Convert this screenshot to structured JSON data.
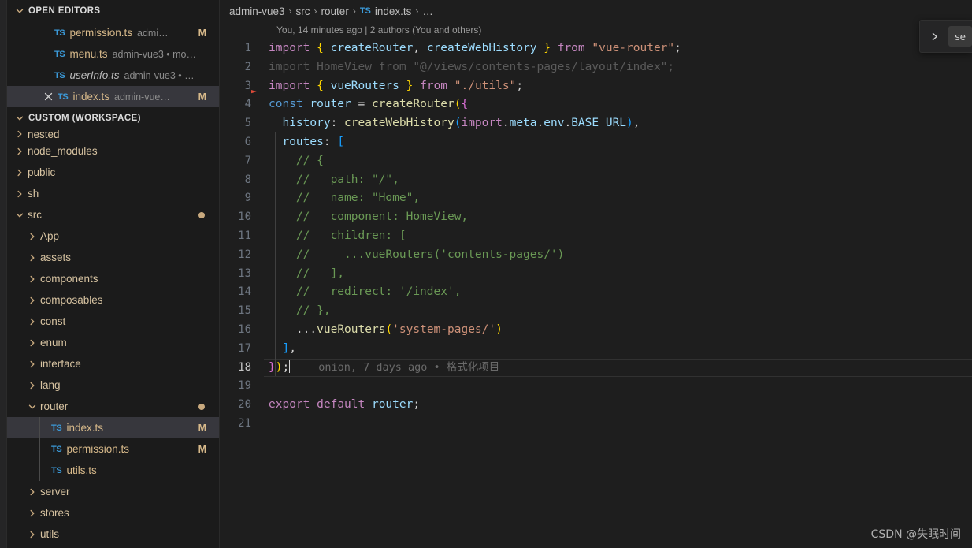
{
  "colors": {
    "editor_bg": "#1e1e1e",
    "sidebar_bg": "#1b1b1b",
    "selection_bg": "#37373d",
    "accent": "#3b9ad9",
    "modified_badge": "#d7b98a",
    "comment": "#6A9955",
    "keyword": "#C586C0",
    "string": "#CE9178",
    "function": "#DCDCAA",
    "variable": "#9CDCFE",
    "bracket1": "#FFD700",
    "breakpoint_marker": "#e04b3a"
  },
  "sidebar": {
    "open_editors": {
      "label": "OPEN EDITORS",
      "twisty": "chevron-down-icon",
      "items": [
        {
          "badge": "TS",
          "name": "permission.ts",
          "meta": "admi…",
          "status": "M",
          "selected": false,
          "italic": false,
          "closable": false
        },
        {
          "badge": "TS",
          "name": "menu.ts",
          "meta": "admin-vue3 • mo…",
          "status": "",
          "selected": false,
          "italic": false,
          "closable": false
        },
        {
          "badge": "TS",
          "name": "userInfo.ts",
          "meta": "admin-vue3 • …",
          "status": "",
          "selected": false,
          "italic": true,
          "closable": false
        },
        {
          "badge": "TS",
          "name": "index.ts",
          "meta": "admin-vue…",
          "status": "M",
          "selected": true,
          "italic": false,
          "closable": true
        }
      ]
    },
    "custom_workspace": {
      "label": "CUSTOM (WORKSPACE)",
      "twisty": "chevron-down-icon",
      "items": [
        {
          "kind": "folder",
          "name": "nested",
          "depth": 1,
          "expanded": false,
          "clipped": true
        },
        {
          "kind": "folder",
          "name": "node_modules",
          "depth": 1,
          "expanded": false
        },
        {
          "kind": "folder",
          "name": "public",
          "depth": 1,
          "expanded": false
        },
        {
          "kind": "folder",
          "name": "sh",
          "depth": 1,
          "expanded": false
        },
        {
          "kind": "folder",
          "name": "src",
          "depth": 1,
          "expanded": true,
          "dot": true
        },
        {
          "kind": "folder",
          "name": "App",
          "depth": 2,
          "expanded": false
        },
        {
          "kind": "folder",
          "name": "assets",
          "depth": 2,
          "expanded": false
        },
        {
          "kind": "folder",
          "name": "components",
          "depth": 2,
          "expanded": false
        },
        {
          "kind": "folder",
          "name": "composables",
          "depth": 2,
          "expanded": false
        },
        {
          "kind": "folder",
          "name": "const",
          "depth": 2,
          "expanded": false
        },
        {
          "kind": "folder",
          "name": "enum",
          "depth": 2,
          "expanded": false
        },
        {
          "kind": "folder",
          "name": "interface",
          "depth": 2,
          "expanded": false
        },
        {
          "kind": "folder",
          "name": "lang",
          "depth": 2,
          "expanded": false
        },
        {
          "kind": "folder",
          "name": "router",
          "depth": 2,
          "expanded": true,
          "dot": true
        },
        {
          "kind": "file",
          "badge": "TS",
          "name": "index.ts",
          "depth": 3,
          "status": "M",
          "selected": true
        },
        {
          "kind": "file",
          "badge": "TS",
          "name": "permission.ts",
          "depth": 3,
          "status": "M",
          "selected": false
        },
        {
          "kind": "file",
          "badge": "TS",
          "name": "utils.ts",
          "depth": 3,
          "status": "",
          "selected": false
        },
        {
          "kind": "folder",
          "name": "server",
          "depth": 2,
          "expanded": false
        },
        {
          "kind": "folder",
          "name": "stores",
          "depth": 2,
          "expanded": false
        },
        {
          "kind": "folder",
          "name": "utils",
          "depth": 2,
          "expanded": false
        }
      ]
    }
  },
  "breadcrumb": {
    "separator": "›",
    "parts": [
      {
        "label": "admin-vue3",
        "icon": ""
      },
      {
        "label": "src",
        "icon": ""
      },
      {
        "label": "router",
        "icon": ""
      },
      {
        "label": "index.ts",
        "icon": "TS"
      },
      {
        "label": "…",
        "icon": ""
      }
    ]
  },
  "editor": {
    "codelens": "You, 14 minutes ago | 2 authors (You and others)",
    "current_line": 18,
    "blame_line_18": "onion, 7 days ago • 格式化项目",
    "lines": [
      {
        "n": 1,
        "tokens": [
          {
            "t": "import",
            "c": "t-kw"
          },
          {
            "t": " ",
            "c": "t-pun"
          },
          {
            "t": "{",
            "c": "t-br1"
          },
          {
            "t": " ",
            "c": "t-pun"
          },
          {
            "t": "createRouter",
            "c": "t-var"
          },
          {
            "t": ",",
            "c": "t-pun"
          },
          {
            "t": " ",
            "c": "t-pun"
          },
          {
            "t": "createWebHistory",
            "c": "t-var"
          },
          {
            "t": " ",
            "c": "t-pun"
          },
          {
            "t": "}",
            "c": "t-br1"
          },
          {
            "t": " ",
            "c": "t-pun"
          },
          {
            "t": "from",
            "c": "t-kw"
          },
          {
            "t": " ",
            "c": "t-pun"
          },
          {
            "t": "\"vue-router\"",
            "c": "t-str"
          },
          {
            "t": ";",
            "c": "t-pun"
          }
        ]
      },
      {
        "n": 2,
        "dim": true,
        "tokens": [
          {
            "t": "import HomeView from \"@/views/contents-pages/layout/index\";",
            "c": "t-dim"
          }
        ]
      },
      {
        "n": 3,
        "tokens": [
          {
            "t": "import",
            "c": "t-kw"
          },
          {
            "t": " ",
            "c": "t-pun"
          },
          {
            "t": "{",
            "c": "t-br1"
          },
          {
            "t": " ",
            "c": "t-pun"
          },
          {
            "t": "vueRouters",
            "c": "t-var"
          },
          {
            "t": " ",
            "c": "t-pun"
          },
          {
            "t": "}",
            "c": "t-br1"
          },
          {
            "t": " ",
            "c": "t-pun"
          },
          {
            "t": "from",
            "c": "t-kw"
          },
          {
            "t": " ",
            "c": "t-pun"
          },
          {
            "t": "\"./utils\"",
            "c": "t-str"
          },
          {
            "t": ";",
            "c": "t-pun"
          }
        ]
      },
      {
        "n": 4,
        "marker": true,
        "tokens": [
          {
            "t": "const",
            "c": "t-kw2"
          },
          {
            "t": " ",
            "c": "t-pun"
          },
          {
            "t": "router",
            "c": "t-var"
          },
          {
            "t": " = ",
            "c": "t-pun"
          },
          {
            "t": "createRouter",
            "c": "t-fn"
          },
          {
            "t": "(",
            "c": "t-br1"
          },
          {
            "t": "{",
            "c": "t-br2"
          }
        ]
      },
      {
        "n": 5,
        "tokens": [
          {
            "t": "  ",
            "c": "t-pun"
          },
          {
            "t": "history",
            "c": "t-var"
          },
          {
            "t": ": ",
            "c": "t-pun"
          },
          {
            "t": "createWebHistory",
            "c": "t-fn"
          },
          {
            "t": "(",
            "c": "t-br3"
          },
          {
            "t": "import",
            "c": "t-kw"
          },
          {
            "t": ".",
            "c": "t-pun"
          },
          {
            "t": "meta",
            "c": "t-var"
          },
          {
            "t": ".",
            "c": "t-pun"
          },
          {
            "t": "env",
            "c": "t-var"
          },
          {
            "t": ".",
            "c": "t-pun"
          },
          {
            "t": "BASE_URL",
            "c": "t-var"
          },
          {
            "t": ")",
            "c": "t-br3"
          },
          {
            "t": ",",
            "c": "t-pun"
          }
        ]
      },
      {
        "n": 6,
        "tokens": [
          {
            "t": "  ",
            "c": "t-pun"
          },
          {
            "t": "routes",
            "c": "t-var"
          },
          {
            "t": ": ",
            "c": "t-pun"
          },
          {
            "t": "[",
            "c": "t-br3"
          }
        ]
      },
      {
        "n": 7,
        "tokens": [
          {
            "t": "    // {",
            "c": "t-cmt"
          }
        ]
      },
      {
        "n": 8,
        "tokens": [
          {
            "t": "    //   path: \"/\",",
            "c": "t-cmt"
          }
        ]
      },
      {
        "n": 9,
        "tokens": [
          {
            "t": "    //   name: \"Home\",",
            "c": "t-cmt"
          }
        ]
      },
      {
        "n": 10,
        "tokens": [
          {
            "t": "    //   component: HomeView,",
            "c": "t-cmt"
          }
        ]
      },
      {
        "n": 11,
        "tokens": [
          {
            "t": "    //   children: [",
            "c": "t-cmt"
          }
        ]
      },
      {
        "n": 12,
        "tokens": [
          {
            "t": "    //     ...vueRouters('contents-pages/')",
            "c": "t-cmt"
          }
        ]
      },
      {
        "n": 13,
        "tokens": [
          {
            "t": "    //   ],",
            "c": "t-cmt"
          }
        ]
      },
      {
        "n": 14,
        "tokens": [
          {
            "t": "    //   redirect: '/index',",
            "c": "t-cmt"
          }
        ]
      },
      {
        "n": 15,
        "tokens": [
          {
            "t": "    // },",
            "c": "t-cmt"
          }
        ]
      },
      {
        "n": 16,
        "tokens": [
          {
            "t": "    ",
            "c": "t-pun"
          },
          {
            "t": "...",
            "c": "t-pun"
          },
          {
            "t": "vueRouters",
            "c": "t-fn"
          },
          {
            "t": "(",
            "c": "t-br1"
          },
          {
            "t": "'system-pages/'",
            "c": "t-str"
          },
          {
            "t": ")",
            "c": "t-br1"
          }
        ]
      },
      {
        "n": 17,
        "tokens": [
          {
            "t": "  ",
            "c": "t-pun"
          },
          {
            "t": "]",
            "c": "t-br3"
          },
          {
            "t": ",",
            "c": "t-pun"
          }
        ]
      },
      {
        "n": 18,
        "current": true,
        "tokens": [
          {
            "t": "}",
            "c": "t-br2"
          },
          {
            "t": ")",
            "c": "t-br1"
          },
          {
            "t": ";",
            "c": "t-pun"
          }
        ]
      },
      {
        "n": 19,
        "tokens": []
      },
      {
        "n": 20,
        "tokens": [
          {
            "t": "export",
            "c": "t-kw"
          },
          {
            "t": " ",
            "c": "t-pun"
          },
          {
            "t": "default",
            "c": "t-kw"
          },
          {
            "t": " ",
            "c": "t-pun"
          },
          {
            "t": "router",
            "c": "t-var"
          },
          {
            "t": ";",
            "c": "t-pun"
          }
        ]
      },
      {
        "n": 21,
        "tokens": []
      }
    ]
  },
  "right_popup": {
    "chevron": "chevron-right-icon",
    "button_label": "se"
  },
  "watermark": "CSDN @失眠时间"
}
